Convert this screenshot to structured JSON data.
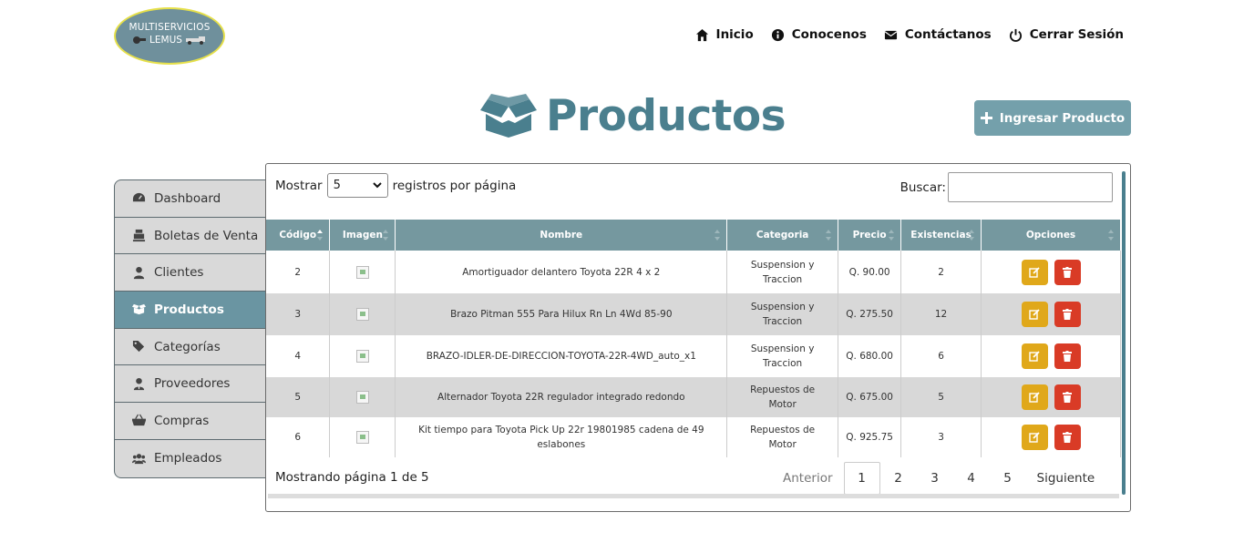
{
  "logo": {
    "line1": "MULTISERVICIOS",
    "line2": "LEMUS"
  },
  "nav": [
    {
      "label": "Inicio",
      "icon": "home-icon"
    },
    {
      "label": "Conocenos",
      "icon": "info-icon"
    },
    {
      "label": "Contáctanos",
      "icon": "envelope-icon"
    },
    {
      "label": "Cerrar Sesión",
      "icon": "power-icon"
    }
  ],
  "page": {
    "title": "Productos",
    "add_button": "Ingresar Producto"
  },
  "sidebar": [
    {
      "label": "Dashboard",
      "icon": "dashboard-icon"
    },
    {
      "label": "Boletas de Venta",
      "icon": "cash-register-icon"
    },
    {
      "label": "Clientes",
      "icon": "user-icon"
    },
    {
      "label": "Productos",
      "icon": "box-icon",
      "active": true
    },
    {
      "label": "Categorías",
      "icon": "tags-icon"
    },
    {
      "label": "Proveedores",
      "icon": "user-tie-icon"
    },
    {
      "label": "Compras",
      "icon": "basket-icon"
    },
    {
      "label": "Empleados",
      "icon": "users-icon"
    }
  ],
  "table_controls": {
    "show_label": "Mostrar",
    "page_size": "5",
    "per_page_label": "registros por página",
    "search_label": "Buscar:"
  },
  "table": {
    "columns": [
      "Código",
      "Imagen",
      "Nombre",
      "Categoria",
      "Precio",
      "Existencias",
      "Opciones"
    ],
    "rows": [
      {
        "codigo": "2",
        "nombre": "Amortiguador delantero Toyota 22R 4 x 2",
        "categoria": "Suspension y Traccion",
        "precio": "Q. 90.00",
        "existencias": "2"
      },
      {
        "codigo": "3",
        "nombre": "Brazo Pitman 555 Para Hilux Rn Ln 4Wd 85-90",
        "categoria": "Suspension y Traccion",
        "precio": "Q. 275.50",
        "existencias": "12"
      },
      {
        "codigo": "4",
        "nombre": "BRAZO-IDLER-DE-DIRECCION-TOYOTA-22R-4WD_auto_x1",
        "categoria": "Suspension y Traccion",
        "precio": "Q. 680.00",
        "existencias": "6"
      },
      {
        "codigo": "5",
        "nombre": "Alternador Toyota 22R regulador integrado redondo",
        "categoria": "Repuestos de Motor",
        "precio": "Q. 675.00",
        "existencias": "5"
      },
      {
        "codigo": "6",
        "nombre": "Kit tiempo para Toyota Pick Up 22r 19801985 cadena de 49 eslabones",
        "categoria": "Repuestos de Motor",
        "precio": "Q. 925.75",
        "existencias": "3"
      }
    ]
  },
  "pagination": {
    "info": "Mostrando página 1 de 5",
    "prev": "Anterior",
    "next": "Siguiente",
    "pages": [
      "1",
      "2",
      "3",
      "4",
      "5"
    ],
    "current": "1"
  },
  "colors": {
    "accent": "#4a7f8e",
    "header": "#75989f",
    "edit": "#e0a81a",
    "delete": "#d93b26"
  }
}
